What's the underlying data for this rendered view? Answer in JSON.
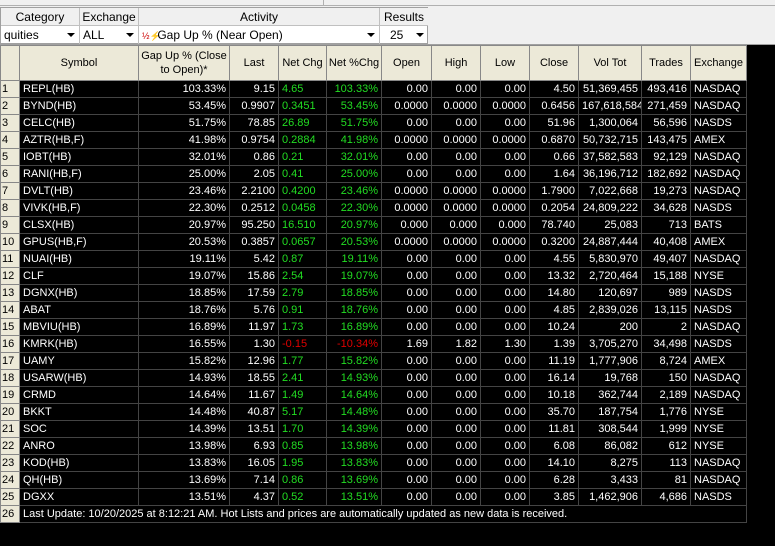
{
  "filters": {
    "category": {
      "label": "Category",
      "value": "quities"
    },
    "exchange": {
      "label": "Exchange",
      "value": "ALL"
    },
    "activity": {
      "label": "Activity",
      "value": "Gap Up % (Near Open)",
      "icon": "gap-up-icon"
    },
    "results": {
      "label": "Results",
      "value": "25"
    }
  },
  "columns": [
    "Symbol",
    "Gap Up % (Close to Open)*",
    "Last",
    "Net Chg",
    "Net %Chg",
    "Open",
    "High",
    "Low",
    "Close",
    "Vol Tot",
    "Trades",
    "Exchange"
  ],
  "colors": {
    "up": "#22dd22",
    "down": "#e00000"
  },
  "rows": [
    [
      "1",
      "REPL(HB)",
      "103.33%",
      "9.15",
      "4.65",
      "103.33%",
      "0.00",
      "0.00",
      "0.00",
      "4.50",
      "51,369,455",
      "493,416",
      "NASDAQ"
    ],
    [
      "2",
      "BYND(HB)",
      "53.45%",
      "0.9907",
      "0.3451",
      "53.45%",
      "0.0000",
      "0.0000",
      "0.0000",
      "0.6456",
      "167,618,584",
      "271,459",
      "NASDAQ"
    ],
    [
      "3",
      "CELC(HB)",
      "51.75%",
      "78.85",
      "26.89",
      "51.75%",
      "0.00",
      "0.00",
      "0.00",
      "51.96",
      "1,300,064",
      "56,596",
      "NASDS"
    ],
    [
      "4",
      "AZTR(HB,F)",
      "41.98%",
      "0.9754",
      "0.2884",
      "41.98%",
      "0.0000",
      "0.0000",
      "0.0000",
      "0.6870",
      "50,732,715",
      "143,475",
      "AMEX"
    ],
    [
      "5",
      "IOBT(HB)",
      "32.01%",
      "0.86",
      "0.21",
      "32.01%",
      "0.00",
      "0.00",
      "0.00",
      "0.66",
      "37,582,583",
      "92,129",
      "NASDAQ"
    ],
    [
      "6",
      "RANI(HB,F)",
      "25.00%",
      "2.05",
      "0.41",
      "25.00%",
      "0.00",
      "0.00",
      "0.00",
      "1.64",
      "36,196,712",
      "182,692",
      "NASDAQ"
    ],
    [
      "7",
      "DVLT(HB)",
      "23.46%",
      "2.2100",
      "0.4200",
      "23.46%",
      "0.0000",
      "0.0000",
      "0.0000",
      "1.7900",
      "7,022,668",
      "19,273",
      "NASDAQ"
    ],
    [
      "8",
      "VIVK(HB,F)",
      "22.30%",
      "0.2512",
      "0.0458",
      "22.30%",
      "0.0000",
      "0.0000",
      "0.0000",
      "0.2054",
      "24,809,222",
      "34,628",
      "NASDS"
    ],
    [
      "9",
      "CLSX(HB)",
      "20.97%",
      "95.250",
      "16.510",
      "20.97%",
      "0.000",
      "0.000",
      "0.000",
      "78.740",
      "25,083",
      "713",
      "BATS"
    ],
    [
      "10",
      "GPUS(HB,F)",
      "20.53%",
      "0.3857",
      "0.0657",
      "20.53%",
      "0.0000",
      "0.0000",
      "0.0000",
      "0.3200",
      "24,887,444",
      "40,408",
      "AMEX"
    ],
    [
      "11",
      "NUAI(HB)",
      "19.11%",
      "5.42",
      "0.87",
      "19.11%",
      "0.00",
      "0.00",
      "0.00",
      "4.55",
      "5,830,970",
      "49,407",
      "NASDAQ"
    ],
    [
      "12",
      "CLF",
      "19.07%",
      "15.86",
      "2.54",
      "19.07%",
      "0.00",
      "0.00",
      "0.00",
      "13.32",
      "2,720,464",
      "15,188",
      "NYSE"
    ],
    [
      "13",
      "DGNX(HB)",
      "18.85%",
      "17.59",
      "2.79",
      "18.85%",
      "0.00",
      "0.00",
      "0.00",
      "14.80",
      "120,697",
      "989",
      "NASDS"
    ],
    [
      "14",
      "ABAT",
      "18.76%",
      "5.76",
      "0.91",
      "18.76%",
      "0.00",
      "0.00",
      "0.00",
      "4.85",
      "2,839,026",
      "13,115",
      "NASDS"
    ],
    [
      "15",
      "MBVIU(HB)",
      "16.89%",
      "11.97",
      "1.73",
      "16.89%",
      "0.00",
      "0.00",
      "0.00",
      "10.24",
      "200",
      "2",
      "NASDAQ"
    ],
    [
      "16",
      "KMRK(HB)",
      "16.55%",
      "1.30",
      "-0.15",
      "-10.34%",
      "1.69",
      "1.82",
      "1.30",
      "1.39",
      "3,705,270",
      "34,498",
      "NASDS"
    ],
    [
      "17",
      "UAMY",
      "15.82%",
      "12.96",
      "1.77",
      "15.82%",
      "0.00",
      "0.00",
      "0.00",
      "11.19",
      "1,777,906",
      "8,724",
      "AMEX"
    ],
    [
      "18",
      "USARW(HB)",
      "14.93%",
      "18.55",
      "2.41",
      "14.93%",
      "0.00",
      "0.00",
      "0.00",
      "16.14",
      "19,768",
      "150",
      "NASDAQ"
    ],
    [
      "19",
      "CRMD",
      "14.64%",
      "11.67",
      "1.49",
      "14.64%",
      "0.00",
      "0.00",
      "0.00",
      "10.18",
      "362,744",
      "2,189",
      "NASDAQ"
    ],
    [
      "20",
      "BKKT",
      "14.48%",
      "40.87",
      "5.17",
      "14.48%",
      "0.00",
      "0.00",
      "0.00",
      "35.70",
      "187,754",
      "1,776",
      "NYSE"
    ],
    [
      "21",
      "SOC",
      "14.39%",
      "13.51",
      "1.70",
      "14.39%",
      "0.00",
      "0.00",
      "0.00",
      "11.81",
      "308,544",
      "1,999",
      "NYSE"
    ],
    [
      "22",
      "ANRO",
      "13.98%",
      "6.93",
      "0.85",
      "13.98%",
      "0.00",
      "0.00",
      "0.00",
      "6.08",
      "86,082",
      "612",
      "NYSE"
    ],
    [
      "23",
      "KOD(HB)",
      "13.83%",
      "16.05",
      "1.95",
      "13.83%",
      "0.00",
      "0.00",
      "0.00",
      "14.10",
      "8,275",
      "113",
      "NASDAQ"
    ],
    [
      "24",
      "QH(HB)",
      "13.69%",
      "7.14",
      "0.86",
      "13.69%",
      "0.00",
      "0.00",
      "0.00",
      "6.28",
      "3,433",
      "81",
      "NASDAQ"
    ],
    [
      "25",
      "DGXX",
      "13.51%",
      "4.37",
      "0.52",
      "13.51%",
      "0.00",
      "0.00",
      "0.00",
      "3.85",
      "1,462,906",
      "4,686",
      "NASDS"
    ]
  ],
  "footer": {
    "row_num": "26",
    "text": "Last Update: 10/20/2025 at 8:12:21 AM.  Hot Lists and prices are automatically updated as new data is received."
  }
}
